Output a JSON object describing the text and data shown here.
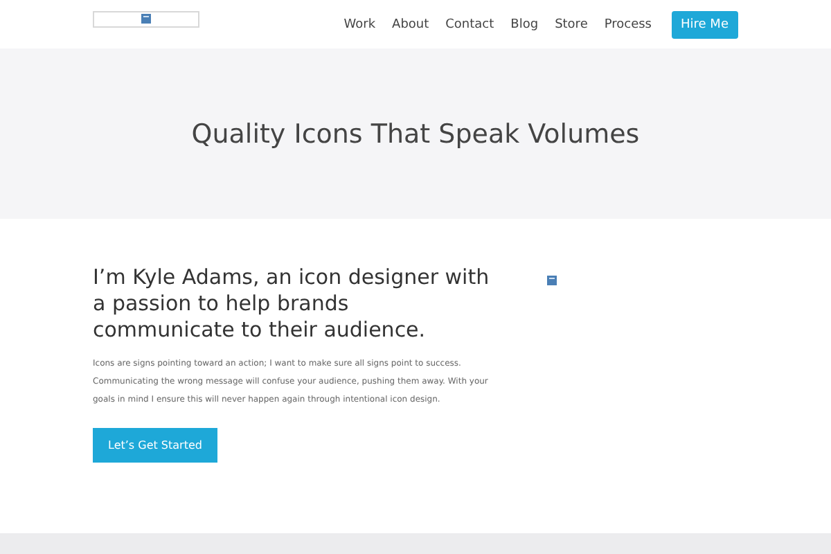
{
  "header": {
    "logo": {
      "kind": "broken-image"
    },
    "nav": [
      {
        "label": "Work"
      },
      {
        "label": "About"
      },
      {
        "label": "Contact"
      },
      {
        "label": "Blog"
      },
      {
        "label": "Store"
      },
      {
        "label": "Process"
      }
    ],
    "cta": "Hire Me"
  },
  "hero": {
    "title": "Quality Icons That Speak Volumes"
  },
  "intro": {
    "heading": "I’m Kyle Adams, an icon designer with a passion to help brands communicate to their audience.",
    "body": "Icons are signs pointing toward an action; I want to make sure all signs point to success. Communicating the wrong message will confuse your audience, pushing them away. With your goals in mind I ensure this will never happen again through intentional icon design.",
    "button": "Let’s Get Started",
    "image": {
      "kind": "broken-image"
    }
  }
}
